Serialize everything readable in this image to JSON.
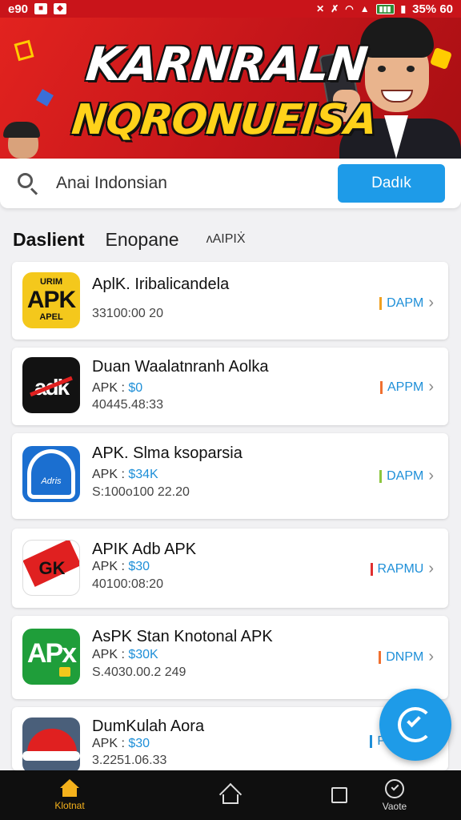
{
  "status_bar": {
    "time": "e90",
    "right_text": "35% 60",
    "icons": [
      "notification-icon",
      "app-icon",
      "no-signal-icon",
      "mute-icon",
      "wifi-icon",
      "signal-icon",
      "battery-icon"
    ]
  },
  "banner": {
    "title_line1": "KARNRALN",
    "title_line2": "NQRONUEISA"
  },
  "search": {
    "value": "Anai Indonsian",
    "button_label": "Dadık"
  },
  "tabs": [
    {
      "label": "Daslient"
    },
    {
      "label": "Enopane"
    },
    {
      "label": "ʌAIPIẊ"
    }
  ],
  "apps": [
    {
      "name": "AplK. Iribalicandela",
      "sub_prefix": "",
      "price": "",
      "date": "33100:00 20",
      "action": "DAPM",
      "bar_color": "#f0a020",
      "icon_lines": [
        "URIM",
        "APK",
        "APEL"
      ]
    },
    {
      "name": "Duan Waalatnranh Aolka",
      "sub_prefix": "APK : ",
      "price": "$0",
      "date": "40445.48:33",
      "action": "APPM",
      "bar_color": "#f07030",
      "icon_lines": [
        "adk"
      ]
    },
    {
      "name": "APK. Slma ksoparsia",
      "sub_prefix": "APK : ",
      "price": "$34K",
      "date": "S:100o100 22.20",
      "action": "DAPM",
      "bar_color": "#8cc63f",
      "icon_lines": [
        "Adris"
      ]
    },
    {
      "name": "APIK Adb APK",
      "sub_prefix": "APK : ",
      "price": "$30",
      "date": "40100:08:20",
      "action": "RAPMU",
      "bar_color": "#e03030",
      "icon_lines": [
        "GK"
      ]
    },
    {
      "name": "AsPK Stan Knotonal APK",
      "sub_prefix": "APK : ",
      "price": "$30K",
      "date": "S.4030.00.2 249",
      "action": "DNPM",
      "bar_color": "#f07030",
      "icon_lines": [
        "APx"
      ]
    },
    {
      "name": "DumKulah Aora",
      "sub_prefix": "APK : ",
      "price": "$30",
      "date": "3.2251.06.33",
      "action": "P",
      "bar_color": "#1e8fd8",
      "icon_lines": []
    }
  ],
  "bottom_nav": [
    {
      "label": "Klotnat",
      "icon": "home-filled-icon",
      "active": true
    },
    {
      "label": "",
      "icon": "home-outline-icon",
      "active": false
    },
    {
      "label": "",
      "icon": "square-icon",
      "active": false
    },
    {
      "label": "Vaote",
      "icon": "check-circle-icon",
      "active": false
    }
  ],
  "colors": {
    "banner_red": "#c9141a",
    "accent_blue": "#1e9be8",
    "nav_active": "#f4b11c",
    "nav_bg": "#0f0f0f"
  }
}
